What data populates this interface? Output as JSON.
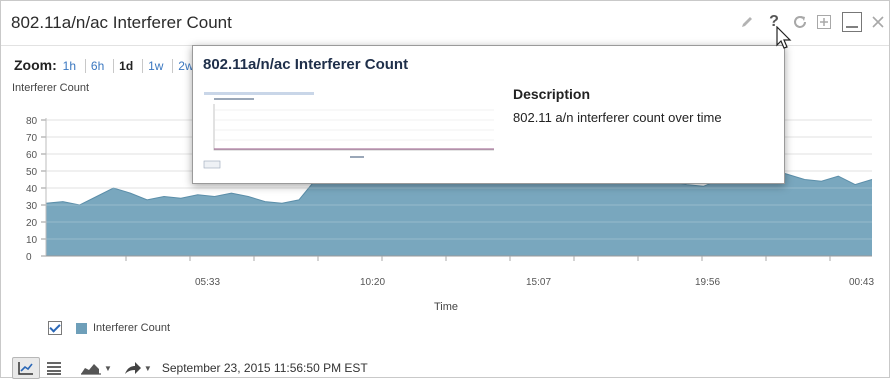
{
  "widget": {
    "title": "802.11a/n/ac Interferer Count",
    "zoom_label": "Zoom:",
    "zoom_options": [
      "1h",
      "6h",
      "1d",
      "1w",
      "2w"
    ],
    "zoom_selected": "1d",
    "timestamp": "September 23, 2015 11:56:50 PM EST"
  },
  "header_icons": [
    "edit-icon",
    "help-icon",
    "refresh-icon",
    "expand-icon",
    "minimize-icon",
    "close-icon"
  ],
  "tooltip": {
    "title": "802.11a/n/ac Interferer Count",
    "description_heading": "Description",
    "description": "802.11 a/n interferer count over time"
  },
  "legend": {
    "label": "Interferer Count",
    "checked": true,
    "color": "#6e9fb9"
  },
  "chart_data": {
    "type": "area",
    "ylabel": "Interferer Count",
    "xlabel": "Time",
    "ylim": [
      0,
      80
    ],
    "yticks": [
      0,
      10,
      20,
      30,
      40,
      50,
      60,
      70,
      80
    ],
    "xtick_labels": [
      "05:33",
      "10:20",
      "15:07",
      "19:56",
      "00:43"
    ],
    "grid": true,
    "series": [
      {
        "name": "Interferer Count",
        "color": "#6e9fb9",
        "values": [
          31,
          32,
          30,
          35,
          40,
          37,
          33,
          35,
          34,
          36,
          35,
          37,
          35,
          32,
          31,
          33,
          45,
          47,
          46,
          48,
          49,
          47,
          48,
          46,
          47,
          49,
          48,
          47,
          46,
          48,
          49,
          47,
          48,
          46,
          47,
          45,
          46,
          44,
          42,
          41,
          45,
          43,
          46,
          51,
          48,
          45,
          44,
          47,
          42,
          45
        ]
      }
    ]
  }
}
